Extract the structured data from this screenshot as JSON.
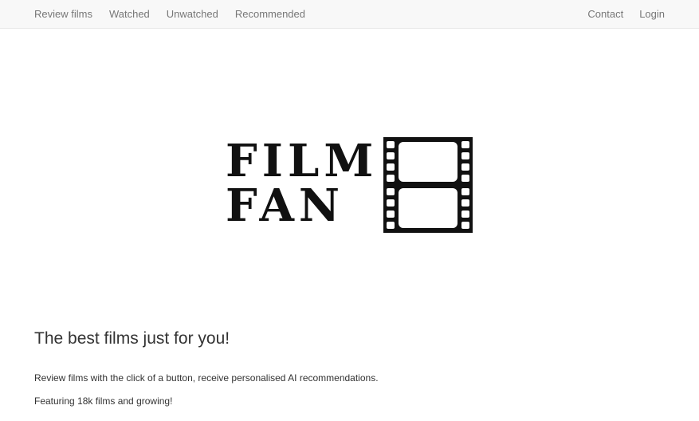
{
  "nav": {
    "left_items": [
      {
        "label": "Review films"
      },
      {
        "label": "Watched"
      },
      {
        "label": "Unwatched"
      },
      {
        "label": "Recommended"
      }
    ],
    "right_items": [
      {
        "label": "Contact"
      },
      {
        "label": "Login"
      }
    ]
  },
  "logo": {
    "line1": "FILM",
    "line2": "FAN",
    "icon": "film-strip-icon"
  },
  "main": {
    "tagline": "The best films just for you!",
    "paragraphs": [
      "Review films with the click of a button, receive personalised AI recommendations.",
      "Featuring 18k films and growing!",
      ""
    ]
  },
  "colors": {
    "navbar_bg": "#f8f8f8",
    "nav_link": "#777777",
    "text": "#333333",
    "logo": "#111111"
  }
}
